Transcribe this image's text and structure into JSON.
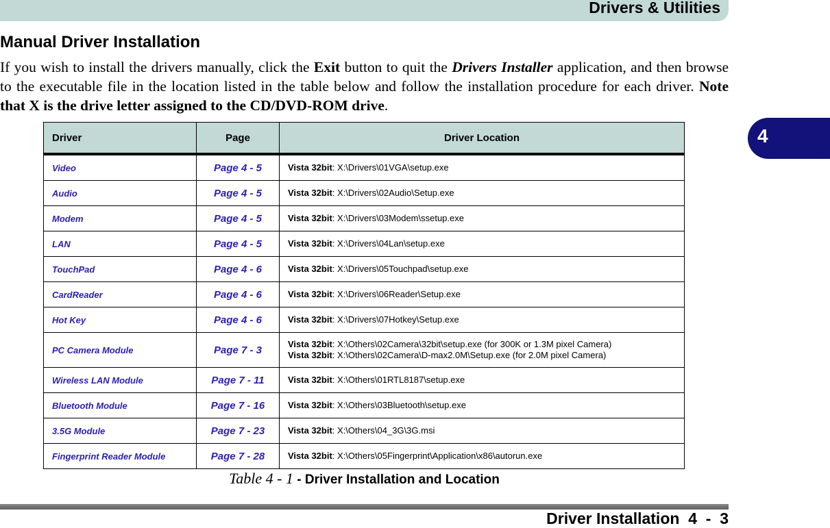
{
  "header": {
    "title": "Drivers & Utilities"
  },
  "chapter_tab": {
    "number": "4"
  },
  "section": {
    "title": "Manual Driver Installation",
    "intro": {
      "p1": "If you wish to install the drivers manually, click the ",
      "exit": "Exit",
      "p2": " button to quit the ",
      "app": "Drivers Installer",
      "p3": " application, and then browse to the executable file in the location listed in the table below and follow the installation procedure for each driver. ",
      "note": "Note that X is the drive letter assigned to the CD/DVD-ROM drive",
      "p4": "."
    }
  },
  "table": {
    "headers": [
      "Driver",
      "Page",
      "Driver Location"
    ],
    "rows": [
      {
        "driver": "Video",
        "page": "Page 4 - 5",
        "locations": [
          {
            "os": "Vista 32bit",
            "path": ": X:\\Drivers\\01VGA\\setup.exe"
          }
        ]
      },
      {
        "driver": "Audio",
        "page": "Page 4 - 5",
        "locations": [
          {
            "os": "Vista 32bit",
            "path": ": X:\\Drivers\\02Audio\\Setup.exe"
          }
        ]
      },
      {
        "driver": "Modem",
        "page": "Page 4 - 5",
        "locations": [
          {
            "os": "Vista 32bit",
            "path": ": X:\\Drivers\\03Modem\\ssetup.exe"
          }
        ]
      },
      {
        "driver": "LAN",
        "page": "Page 4 - 5",
        "locations": [
          {
            "os": "Vista 32bit",
            "path": ": X:\\Drivers\\04Lan\\setup.exe"
          }
        ]
      },
      {
        "driver": "TouchPad",
        "page": "Page 4 - 6",
        "locations": [
          {
            "os": "Vista 32bit",
            "path": ": X:\\Drivers\\05Touchpad\\setup.exe"
          }
        ]
      },
      {
        "driver": "CardReader",
        "page": "Page 4 - 6",
        "locations": [
          {
            "os": "Vista 32bit",
            "path": ": X:\\Drivers\\06Reader\\Setup.exe"
          }
        ]
      },
      {
        "driver": "Hot Key",
        "page": "Page 4 - 6",
        "locations": [
          {
            "os": "Vista 32bit",
            "path": ": X:\\Drivers\\07Hotkey\\Setup.exe"
          }
        ]
      },
      {
        "driver": "PC Camera Module",
        "page": "Page 7 - 3",
        "locations": [
          {
            "os": "Vista 32bit",
            "path": ": X:\\Others\\02Camera\\32bit\\setup.exe (for 300K or 1.3M pixel Camera)"
          },
          {
            "os": "Vista 32bit",
            "path": ": X:\\Others\\02Camera\\D-max2.0M\\Setup.exe (for 2.0M pixel Camera)"
          }
        ]
      },
      {
        "driver": "Wireless LAN Module",
        "page": "Page 7 - 11",
        "locations": [
          {
            "os": "Vista 32bit",
            "path": ": X:\\Others\\01RTL8187\\setup.exe"
          }
        ]
      },
      {
        "driver": "Bluetooth Module",
        "page": "Page 7 - 16",
        "locations": [
          {
            "os": "Vista 32bit",
            "path": ": X:\\Others\\03Bluetooth\\setup.exe"
          }
        ]
      },
      {
        "driver": "3.5G Module",
        "page": "Page 7 - 23",
        "locations": [
          {
            "os": "Vista 32bit",
            "path": ": X:\\Others\\04_3G\\3G.msi"
          }
        ]
      },
      {
        "driver": "Fingerprint Reader Module",
        "page": "Page 7 - 28",
        "locations": [
          {
            "os": "Vista 32bit",
            "path": ": X:\\Others\\05Fingerprint\\Application\\x86\\autorun.exe"
          }
        ]
      }
    ]
  },
  "caption": {
    "label": "Table 4 - 1",
    "text": " - Driver Installation and Location"
  },
  "footer": {
    "text": "Driver Installation  4  -  3"
  },
  "colors": {
    "header_bg": "#c2d9d6",
    "chapter_tab": "#13127a",
    "link": "#2a1fae"
  }
}
